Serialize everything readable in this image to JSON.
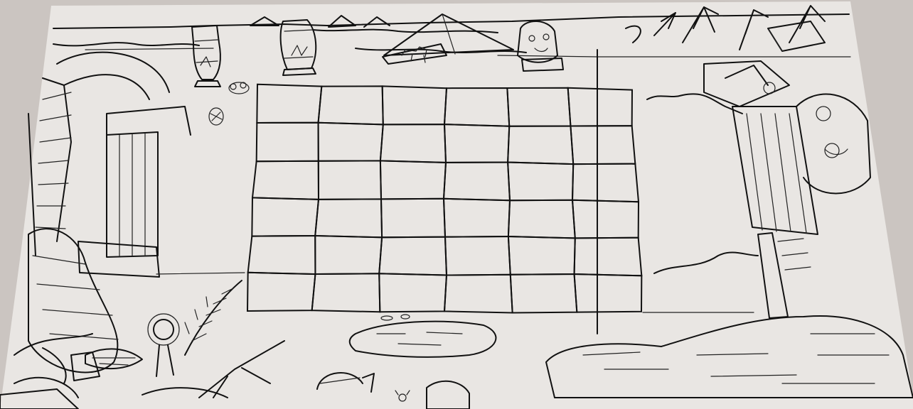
{
  "scene": {
    "kind": "hand-drawn Egyptian temple level sketch",
    "paper_color": "#e9e6e3",
    "ink_color": "#111111",
    "shadow_color": "#cbc5c1"
  },
  "grid": {
    "rows": 6,
    "cols": 6
  },
  "props": {
    "left": [
      "stone-arch",
      "pillars",
      "striped-urn",
      "plants",
      "fern",
      "sunflower-fan"
    ],
    "top": [
      "pyramid",
      "small-pyramids",
      "tall-vase",
      "round-jar",
      "camel-sign",
      "pharaoh-head",
      "palm-trees",
      "scattered-stones"
    ],
    "right": [
      "pharaoh-statue",
      "column-pillar",
      "water-pool"
    ],
    "bottom": [
      "pond",
      "palm-leaves",
      "half-buried-ball",
      "small-bug",
      "rocks"
    ]
  }
}
